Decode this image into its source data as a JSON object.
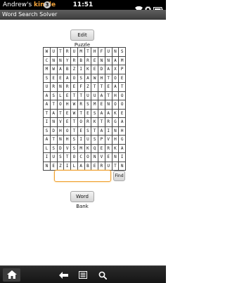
{
  "status_bar": {
    "owner_prefix": "Andrew's",
    "owner_brand": "kindle",
    "notification_count": "3",
    "time": "11:51"
  },
  "app": {
    "title": "Word Search Solver"
  },
  "buttons": {
    "edit_puzzle": "Edit Puzzle",
    "find": "Find",
    "word_bank": "Word Bank"
  },
  "search": {
    "value": "",
    "placeholder": ""
  },
  "puzzle": {
    "rows": [
      [
        "W",
        "U",
        "T",
        "R",
        "U",
        "M",
        "T",
        "H",
        "F",
        "U",
        "N",
        "S"
      ],
      [
        "C",
        "N",
        "N",
        "Y",
        "R",
        "B",
        "R",
        "E",
        "N",
        "N",
        "A",
        "M"
      ],
      [
        "M",
        "W",
        "A",
        "B",
        "Z",
        "I",
        "K",
        "E",
        "D",
        "A",
        "X",
        "P"
      ],
      [
        "S",
        "E",
        "E",
        "A",
        "O",
        "S",
        "A",
        "W",
        "H",
        "T",
        "O",
        "E"
      ],
      [
        "U",
        "R",
        "N",
        "R",
        "E",
        "F",
        "Z",
        "T",
        "T",
        "E",
        "A",
        "T"
      ],
      [
        "A",
        "S",
        "L",
        "E",
        "T",
        "T",
        "U",
        "U",
        "A",
        "T",
        "H",
        "O"
      ],
      [
        "A",
        "T",
        "O",
        "H",
        "W",
        "R",
        "S",
        "M",
        "E",
        "N",
        "O",
        "O"
      ],
      [
        "T",
        "A",
        "T",
        "E",
        "W",
        "T",
        "E",
        "S",
        "A",
        "A",
        "K",
        "E"
      ],
      [
        "I",
        "N",
        "V",
        "E",
        "T",
        "O",
        "R",
        "K",
        "T",
        "R",
        "G",
        "A"
      ],
      [
        "S",
        "D",
        "H",
        "O",
        "T",
        "E",
        "S",
        "T",
        "A",
        "I",
        "N",
        "H"
      ],
      [
        "A",
        "T",
        "N",
        "H",
        "S",
        "I",
        "U",
        "S",
        "P",
        "V",
        "H",
        "G"
      ],
      [
        "L",
        "S",
        "D",
        "V",
        "S",
        "M",
        "K",
        "Q",
        "E",
        "R",
        "K",
        "A"
      ],
      [
        "I",
        "U",
        "S",
        "T",
        "O",
        "C",
        "O",
        "N",
        "V",
        "E",
        "N",
        "I"
      ],
      [
        "N",
        "E",
        "Z",
        "I",
        "L",
        "A",
        "B",
        "E",
        "R",
        "U",
        "T",
        "N"
      ]
    ]
  },
  "icons": {
    "wifi": "wifi-icon",
    "settings": "gear-icon",
    "battery": "battery-icon",
    "home": "home-icon",
    "back": "back-arrow-icon",
    "menu": "menu-icon",
    "search": "search-icon"
  },
  "colors": {
    "brand_kindle": "#f3a33a",
    "input_focus": "#f0a030"
  }
}
